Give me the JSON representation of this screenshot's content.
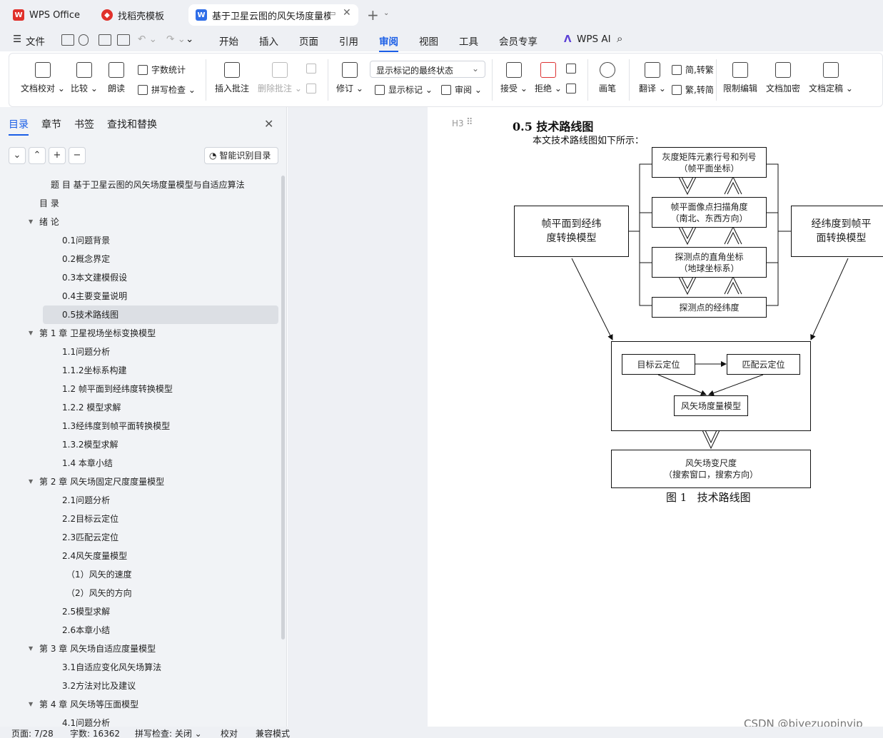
{
  "tabs": [
    {
      "label": "WPS Office"
    },
    {
      "label": "找稻壳模板"
    },
    {
      "label": "基于卫星云图的风矢场度量模型"
    }
  ],
  "menu": {
    "file": "文件",
    "items": [
      "开始",
      "插入",
      "页面",
      "引用",
      "审阅",
      "视图",
      "工具",
      "会员专享"
    ],
    "active": "审阅",
    "ai": "WPS AI"
  },
  "ribbon": {
    "doc_check": "文档校对",
    "compare": "比较",
    "read_aloud": "朗读",
    "word_count": "字数统计",
    "spell_check": "拼写检查",
    "insert_comment": "插入批注",
    "delete_comment": "删除批注",
    "revise": "修订",
    "markup_state": "显示标记的最终状态",
    "show_markup": "显示标记",
    "review": "审阅",
    "accept": "接受",
    "reject": "拒绝",
    "pen": "画笔",
    "translate": "翻译",
    "to_traditional": "简,转繁",
    "to_simplified": "繁,转简",
    "restrict_edit": "限制编辑",
    "encrypt": "文档加密",
    "finalize": "文档定稿"
  },
  "sidebar": {
    "tabs": [
      "目录",
      "章节",
      "书签",
      "查找和替换"
    ],
    "smart_button": "智能识别目录",
    "toc": [
      {
        "text": "题 目 基于卫星云图的风矢场度量模型与自适应算法",
        "level": 0
      },
      {
        "text": "目 录",
        "level": 1
      },
      {
        "text": "绪 论",
        "level": 1,
        "expand": true
      },
      {
        "text": "0.1问题背景",
        "level": 2
      },
      {
        "text": "0.2概念界定",
        "level": 2
      },
      {
        "text": "0.3本文建模假设",
        "level": 2
      },
      {
        "text": "0.4主要变量说明",
        "level": 2
      },
      {
        "text": "0.5技术路线图",
        "level": 2,
        "selected": true
      },
      {
        "text": "第 1 章 卫星视场坐标变换模型",
        "level": 1,
        "expand": true
      },
      {
        "text": "1.1问题分析",
        "level": 2
      },
      {
        "text": "1.1.2坐标系构建",
        "level": 2
      },
      {
        "text": "1.2 帧平面到经纬度转换模型",
        "level": 2
      },
      {
        "text": "1.2.2 模型求解",
        "level": 2
      },
      {
        "text": "1.3经纬度到帧平面转换模型",
        "level": 2
      },
      {
        "text": "1.3.2模型求解",
        "level": 2
      },
      {
        "text": "1.4 本章小结",
        "level": 2
      },
      {
        "text": "第 2 章 风矢场固定尺度度量模型",
        "level": 1,
        "expand": true
      },
      {
        "text": "2.1问题分析",
        "level": 2
      },
      {
        "text": "2.2目标云定位",
        "level": 2
      },
      {
        "text": "2.3匹配云定位",
        "level": 2
      },
      {
        "text": "2.4风矢度量模型",
        "level": 2
      },
      {
        "text": "（1）风矢的速度",
        "level": 3
      },
      {
        "text": "（2）风矢的方向",
        "level": 3
      },
      {
        "text": "2.5模型求解",
        "level": 2
      },
      {
        "text": "2.6本章小结",
        "level": 2
      },
      {
        "text": "第 3 章 风矢场自适应度量模型",
        "level": 1,
        "expand": true
      },
      {
        "text": "3.1自适应变化风矢场算法",
        "level": 2
      },
      {
        "text": "3.2方法对比及建议",
        "level": 2
      },
      {
        "text": "第 4 章 风矢场等压面模型",
        "level": 1,
        "expand": true
      },
      {
        "text": "4.1问题分析",
        "level": 2
      }
    ]
  },
  "document": {
    "heading_marker": "H3",
    "heading": "0.5  技术路线图",
    "intro": "本文技术路线图如下所示：",
    "caption": "图 1   技术路线图",
    "diagram": {
      "box1": [
        "灰度矩阵元素行号和列号",
        "（帧平面坐标）"
      ],
      "box2": [
        "帧平面像点扫描角度",
        "（南北、东西方向）"
      ],
      "box3": [
        "探测点的直角坐标",
        "（地球坐标系）"
      ],
      "box4": [
        "探测点的经纬度"
      ],
      "left_box": [
        "帧平面到经纬",
        "度转换模型"
      ],
      "right_box": [
        "经纬度到帧平",
        "面转换模型"
      ],
      "target": "目标云定位",
      "match": "匹配云定位",
      "model": "风矢场度量模型",
      "result": [
        "风矢场变尺度",
        "（搜索窗口，搜索方向）"
      ]
    }
  },
  "status": {
    "page": "页面: 7/28",
    "words": "字数: 16362",
    "spell": "拼写检查: 关闭",
    "proof": "校对",
    "compat": "兼容模式"
  },
  "watermark": "CSDN @biyezuopinvip"
}
